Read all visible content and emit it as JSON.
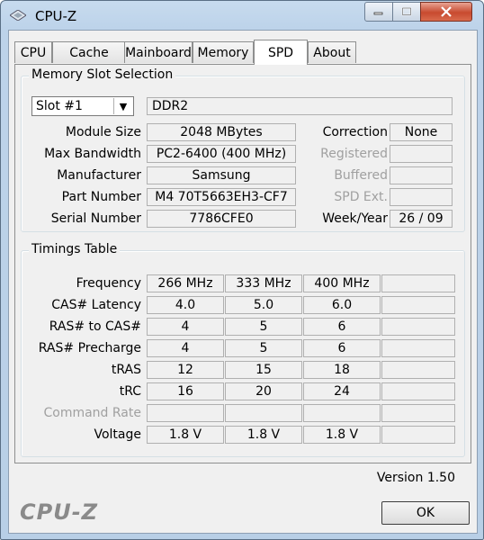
{
  "window": {
    "title": "CPU-Z"
  },
  "tabs": [
    {
      "label": "CPU"
    },
    {
      "label": "Cache"
    },
    {
      "label": "Mainboard"
    },
    {
      "label": "Memory"
    },
    {
      "label": "SPD"
    },
    {
      "label": "About"
    }
  ],
  "active_tab": "SPD",
  "slot_section": {
    "legend": "Memory Slot Selection",
    "slot_value": "Slot #1",
    "memory_type": "DDR2",
    "labels": {
      "module_size": "Module Size",
      "max_bandwidth": "Max Bandwidth",
      "manufacturer": "Manufacturer",
      "part_number": "Part Number",
      "serial_number": "Serial Number",
      "correction": "Correction",
      "registered": "Registered",
      "buffered": "Buffered",
      "spd_ext": "SPD Ext.",
      "week_year": "Week/Year"
    },
    "values": {
      "module_size": "2048 MBytes",
      "max_bandwidth": "PC2-6400 (400 MHz)",
      "manufacturer": "Samsung",
      "part_number": "M4 70T5663EH3-CF7",
      "serial_number": "7786CFE0",
      "correction": "None",
      "registered": "",
      "buffered": "",
      "spd_ext": "",
      "week_year": "26 / 09"
    }
  },
  "timings": {
    "legend": "Timings Table",
    "rows": [
      {
        "label": "Frequency",
        "cells": [
          "266 MHz",
          "333 MHz",
          "400 MHz",
          ""
        ]
      },
      {
        "label": "CAS# Latency",
        "cells": [
          "4.0",
          "5.0",
          "6.0",
          ""
        ]
      },
      {
        "label": "RAS# to CAS#",
        "cells": [
          "4",
          "5",
          "6",
          ""
        ]
      },
      {
        "label": "RAS# Precharge",
        "cells": [
          "4",
          "5",
          "6",
          ""
        ]
      },
      {
        "label": "tRAS",
        "cells": [
          "12",
          "15",
          "18",
          ""
        ]
      },
      {
        "label": "tRC",
        "cells": [
          "16",
          "20",
          "24",
          ""
        ]
      },
      {
        "label": "Command Rate",
        "cells": [
          "",
          "",
          "",
          ""
        ]
      },
      {
        "label": "Voltage",
        "cells": [
          "1.8 V",
          "1.8 V",
          "1.8 V",
          ""
        ]
      }
    ]
  },
  "footer": {
    "version": "Version 1.50",
    "logo": "CPU-Z",
    "ok_label": "OK"
  }
}
